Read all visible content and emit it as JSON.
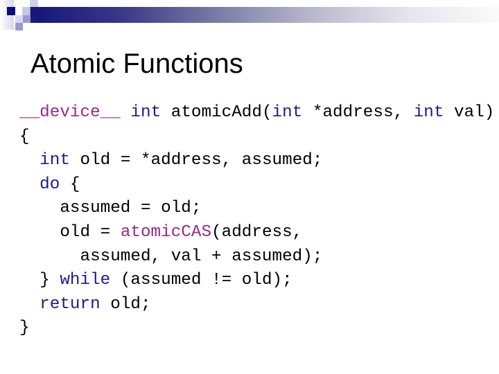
{
  "slide": {
    "title": "Atomic Functions",
    "colors": {
      "banner_start": "#14147a",
      "banner_end": "#fbfbfd",
      "keyword": "#1c1c8c",
      "qualifier": "#9a2888",
      "text": "#000000"
    },
    "decoration": {
      "icon": "squares-motif-icon",
      "banner": "gradient-bar"
    },
    "code": {
      "lines": [
        {
          "tokens": [
            {
              "text": "__device__",
              "kind": "qualifier"
            },
            {
              "text": " ",
              "kind": "plain"
            },
            {
              "text": "int",
              "kind": "keyword"
            },
            {
              "text": " atomicAdd(",
              "kind": "plain"
            },
            {
              "text": "int",
              "kind": "keyword"
            },
            {
              "text": " *address, ",
              "kind": "plain"
            },
            {
              "text": "int",
              "kind": "keyword"
            },
            {
              "text": " val)",
              "kind": "plain"
            }
          ]
        },
        {
          "tokens": [
            {
              "text": "{",
              "kind": "plain"
            }
          ]
        },
        {
          "tokens": [
            {
              "text": "  ",
              "kind": "plain"
            },
            {
              "text": "int",
              "kind": "keyword"
            },
            {
              "text": " old = *address, assumed;",
              "kind": "plain"
            }
          ]
        },
        {
          "tokens": [
            {
              "text": "  ",
              "kind": "plain"
            },
            {
              "text": "do",
              "kind": "keyword"
            },
            {
              "text": " {",
              "kind": "plain"
            }
          ]
        },
        {
          "tokens": [
            {
              "text": "    assumed = old;",
              "kind": "plain"
            }
          ]
        },
        {
          "tokens": [
            {
              "text": "    old = ",
              "kind": "plain"
            },
            {
              "text": "atomicCAS",
              "kind": "qualifier"
            },
            {
              "text": "(address,",
              "kind": "plain"
            }
          ]
        },
        {
          "tokens": [
            {
              "text": "      assumed, val + assumed);",
              "kind": "plain"
            }
          ]
        },
        {
          "tokens": [
            {
              "text": "  } ",
              "kind": "plain"
            },
            {
              "text": "while",
              "kind": "keyword"
            },
            {
              "text": " (assumed != old);",
              "kind": "plain"
            }
          ]
        },
        {
          "tokens": [
            {
              "text": "  ",
              "kind": "plain"
            },
            {
              "text": "return",
              "kind": "keyword"
            },
            {
              "text": " old;",
              "kind": "plain"
            }
          ]
        },
        {
          "tokens": [
            {
              "text": "}",
              "kind": "plain"
            }
          ]
        }
      ]
    }
  }
}
